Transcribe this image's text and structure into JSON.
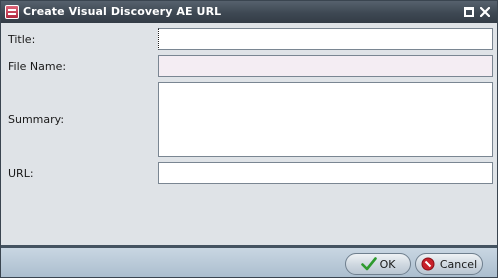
{
  "window": {
    "title": "Create Visual Discovery AE URL"
  },
  "icons": {
    "app": "app-icon",
    "maximize": "maximize-icon",
    "close": "close-icon",
    "ok": "check-icon",
    "cancel": "cancel-icon"
  },
  "form": {
    "title_label": "Title:",
    "title_value": "",
    "file_name_label": "File Name:",
    "file_name_value": "",
    "summary_label": "Summary:",
    "summary_value": "",
    "url_label": "URL:",
    "url_value": ""
  },
  "buttons": {
    "ok_label": "OK",
    "cancel_label": "Cancel"
  },
  "colors": {
    "titlebar": "#3e4853",
    "dialog_bg": "#dfe3e7",
    "readonly_field": "#f4edf3",
    "ok_check": "#2e9a2e",
    "cancel_icon": "#c8202a"
  }
}
